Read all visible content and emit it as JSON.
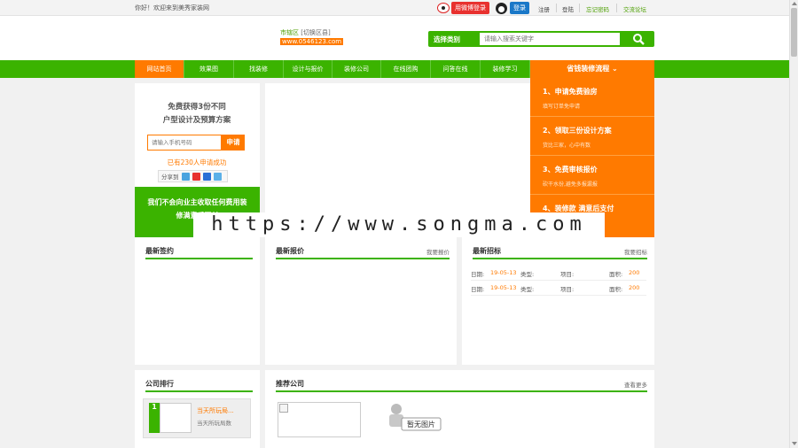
{
  "topbar": {
    "welcome": "你好！欢迎来到美秀家装网",
    "weibo_login": "用微博登录",
    "qq_login": "登录",
    "links": [
      "注册",
      "登陆",
      "忘记密码",
      "交流论坛"
    ]
  },
  "header": {
    "city": "市辖区",
    "switch": "[切换区县]",
    "domain": "www.0546123.com",
    "search_category": "选择类别",
    "search_placeholder": "请输入搜索关键字"
  },
  "nav": {
    "items": [
      "网站首页",
      "效果图",
      "找装修",
      "设计与报价",
      "装修公司",
      "在线团购",
      "问答在线",
      "装修学习"
    ],
    "active_index": 0,
    "flow_title": "省钱装修流程"
  },
  "apply": {
    "title_line1": "免费获得3份不同",
    "title_line2": "户型设计及预算方案",
    "phone_placeholder": "请输入手机号码",
    "button": "申请",
    "count_text": "已有230人申请成功",
    "share_label": "分享到"
  },
  "promo": {
    "line1": "我们不会向业主收取任何费用装",
    "line2": "修满意后再付"
  },
  "steps": [
    {
      "title": "1、申请免费验房",
      "desc": "填写订单免申请"
    },
    {
      "title": "2、领取三份设计方案",
      "desc": "货比三家，心中有数"
    },
    {
      "title": "3、免费审核报价",
      "desc": "砍干水份,避免多报漏报"
    },
    {
      "title": "4、装修款 满意后支付",
      "desc": ""
    }
  ],
  "watermark": "https://www.songma.com",
  "sections": {
    "signing": {
      "title": "最新签约"
    },
    "quote": {
      "title": "最新报价",
      "more": "我要报价"
    },
    "bid": {
      "title": "最新招标",
      "more": "我要招标",
      "rows": [
        {
          "date_label": "日期:",
          "date": "19-05-13",
          "type_label": "类型:",
          "item_label": "项目:",
          "area_label": "面积:",
          "area": "200"
        },
        {
          "date_label": "日期:",
          "date": "19-05-13",
          "type_label": "类型:",
          "item_label": "项目:",
          "area_label": "面积:",
          "area": "200"
        }
      ]
    },
    "ranking": {
      "title": "公司排行",
      "rank_num": "1",
      "company": "当天所玩局...",
      "sub": "当天所玩局数"
    },
    "recommend": {
      "title": "推荐公司",
      "more": "查看更多",
      "no_image": "暂无图片"
    }
  },
  "colors": {
    "green": "#3bb300",
    "orange": "#ff7a00",
    "weibo_red": "#e8312f",
    "qq_blue": "#1a78c8"
  }
}
